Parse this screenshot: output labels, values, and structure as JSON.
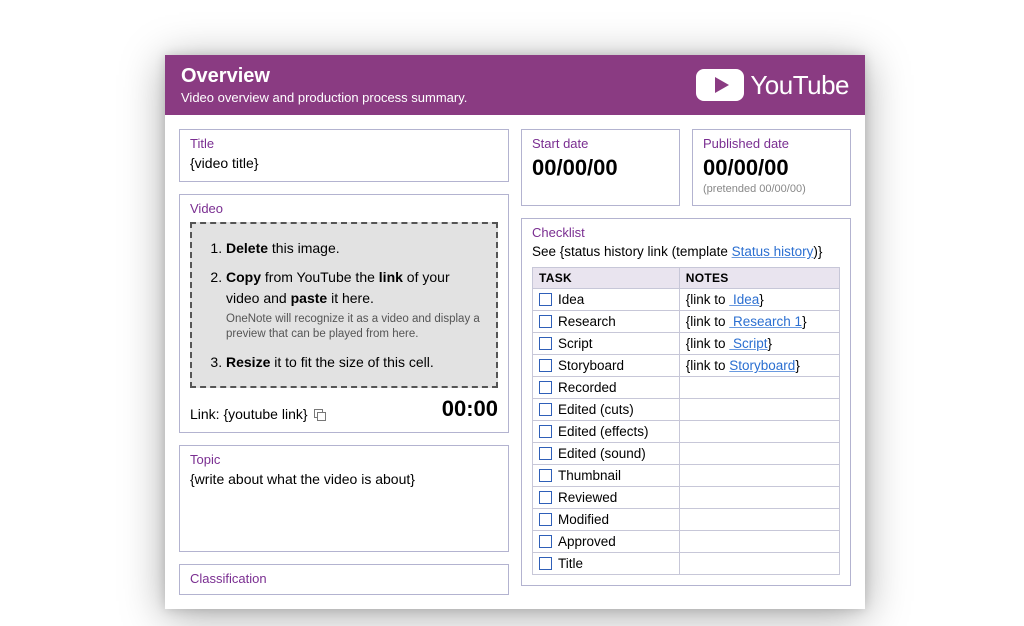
{
  "banner": {
    "title": "Overview",
    "subtitle": "Video overview and production process summary.",
    "logo_text": "YouTube"
  },
  "title_card": {
    "label": "Title",
    "value": "{video title}"
  },
  "video_card": {
    "label": "Video",
    "step1_pre": "Delete",
    "step1_post": " this image.",
    "step2_a": "Copy",
    "step2_b": " from YouTube the ",
    "step2_c": "link",
    "step2_d": " of your video and ",
    "step2_e": "paste",
    "step2_f": " it here.",
    "hint": "OneNote will recognize it as a video and display a preview that can be played from here.",
    "step3_a": "Resize",
    "step3_b": " it to fit the size of this cell.",
    "link_label": "Link: ",
    "link_value": "{youtube link}",
    "time": "00:00"
  },
  "topic_card": {
    "label": "Topic",
    "value": "{write about what the video is about}"
  },
  "classification_card": {
    "label": "Classification"
  },
  "start_date": {
    "label": "Start date",
    "value": "00/00/00"
  },
  "published_date": {
    "label": "Published date",
    "value": "00/00/00",
    "sub": "(pretended 00/00/00)"
  },
  "checklist": {
    "label": "Checklist",
    "see_prefix": "See {status history link (template ",
    "see_link": "Status history",
    "see_suffix": ")}",
    "col_task": "TASK",
    "col_notes": "NOTES",
    "rows": [
      {
        "task": "Idea",
        "note_pre": "{link to ",
        "note_link": "Idea",
        "note_post": "}"
      },
      {
        "task": "Research",
        "note_pre": "{link to ",
        "note_link": "Research 1",
        "note_post": "}"
      },
      {
        "task": "Script",
        "note_pre": "{link to ",
        "note_link": "Script",
        "note_post": "}"
      },
      {
        "task": "Storyboard",
        "note_pre": "{link to ",
        "note_link": "Storyboard",
        "note_post": "}"
      },
      {
        "task": "Recorded",
        "note_pre": "",
        "note_link": "",
        "note_post": ""
      },
      {
        "task": "Edited (cuts)",
        "note_pre": "",
        "note_link": "",
        "note_post": ""
      },
      {
        "task": "Edited (effects)",
        "note_pre": "",
        "note_link": "",
        "note_post": ""
      },
      {
        "task": "Edited (sound)",
        "note_pre": "",
        "note_link": "",
        "note_post": ""
      },
      {
        "task": "Thumbnail",
        "note_pre": "",
        "note_link": "",
        "note_post": ""
      },
      {
        "task": "Reviewed",
        "note_pre": "",
        "note_link": "",
        "note_post": ""
      },
      {
        "task": "Modified",
        "note_pre": "",
        "note_link": "",
        "note_post": ""
      },
      {
        "task": "Approved",
        "note_pre": "",
        "note_link": "",
        "note_post": ""
      },
      {
        "task": "Title",
        "note_pre": "",
        "note_link": "",
        "note_post": ""
      }
    ]
  }
}
